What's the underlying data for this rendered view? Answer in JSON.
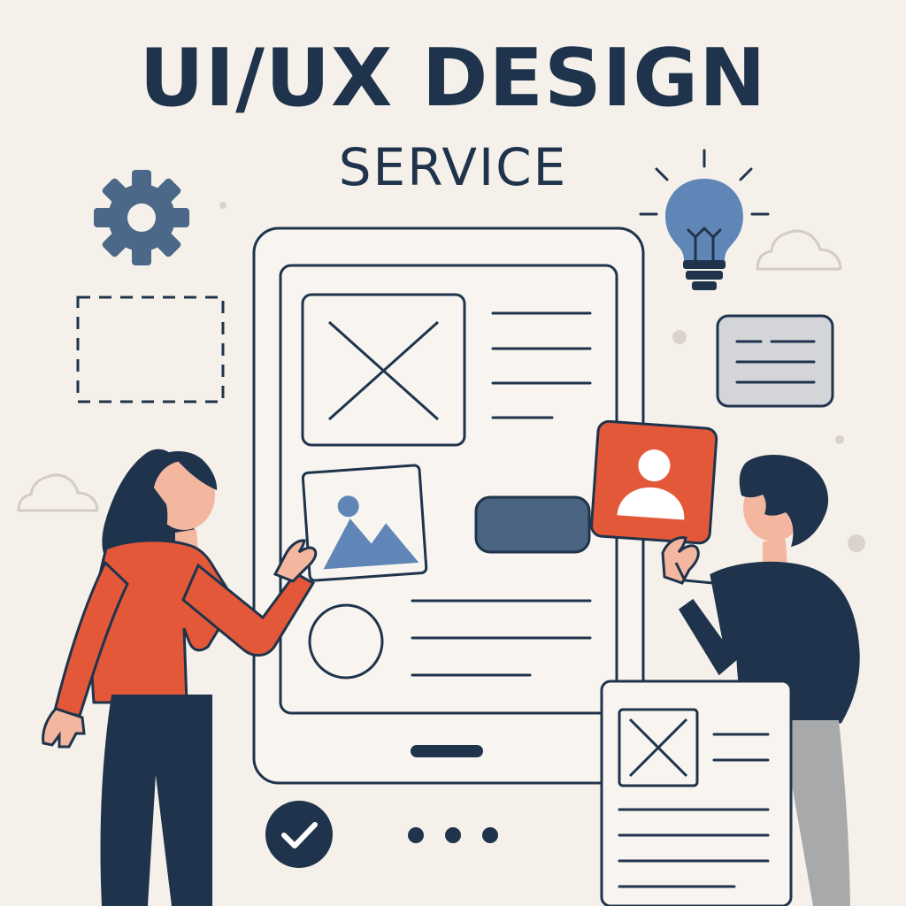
{
  "heading": {
    "title": "UI/UX DESIGN",
    "subtitle": "SERVICE"
  },
  "colors": {
    "background": "#f5f1ea",
    "navy": "#1f344c",
    "orange": "#e4583a",
    "blue": "#5f86b6",
    "gray": "#b7b7b7",
    "skin": "#f3b7a0"
  },
  "icons": [
    "gear-icon",
    "lightbulb-icon",
    "checkmark-icon",
    "more-icon",
    "user-icon",
    "image-icon",
    "image-placeholder-icon",
    "cloud-icon"
  ]
}
